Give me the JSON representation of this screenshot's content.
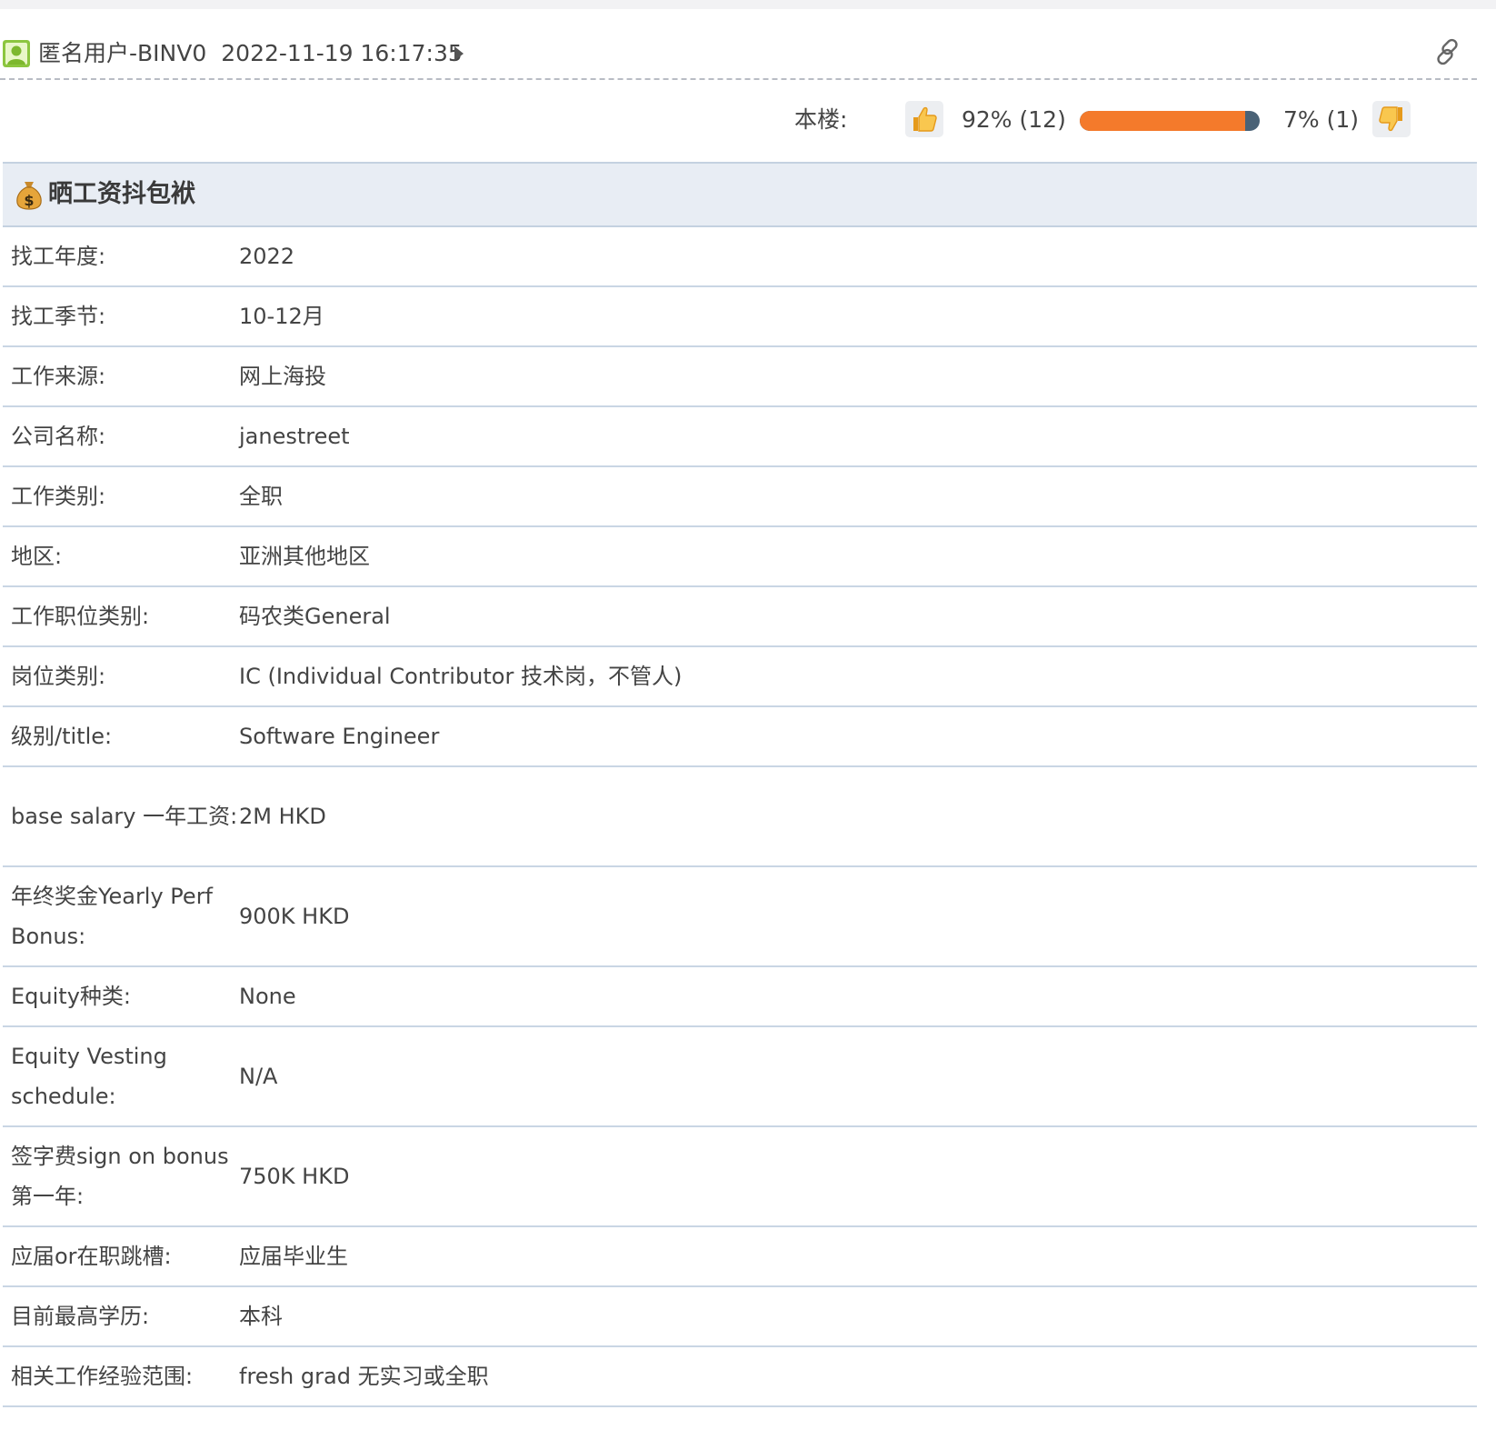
{
  "header": {
    "author": "匿名用户-BINV0",
    "timestamp": "2022-11-19 16:17:35",
    "icons": {
      "avatar": "user-avatar-icon",
      "expand": "caret-right-icon",
      "permalink": "link-icon"
    }
  },
  "votes": {
    "label": "本楼:",
    "up_text": "92% (12)",
    "down_text": "7% (1)",
    "up_fraction": 0.92,
    "colors": {
      "up": "#f47a2b",
      "down": "#4a6276"
    }
  },
  "section": {
    "icon": "money-bag-icon",
    "title": "晒工资抖包袱"
  },
  "rows": [
    {
      "label": "找工年度:",
      "value": "2022"
    },
    {
      "label": "找工季节:",
      "value": "10-12月"
    },
    {
      "label": "工作来源:",
      "value": "网上海投"
    },
    {
      "label": "公司名称:",
      "value": "janestreet"
    },
    {
      "label": "工作类别:",
      "value": "全职"
    },
    {
      "label": "地区:",
      "value": "亚洲其他地区"
    },
    {
      "label": "工作职位类别:",
      "value": "码农类General"
    },
    {
      "label": "岗位类别:",
      "value": "IC (Individual Contributor 技术岗，不管人)"
    },
    {
      "label": "级别/title:",
      "value": "Software Engineer"
    },
    {
      "label": "base salary 一年工资:",
      "value": "2M HKD"
    },
    {
      "label": "年终奖金Yearly Perf Bonus:",
      "value": "900K HKD"
    },
    {
      "label": "Equity种类:",
      "value": "None"
    },
    {
      "label": "Equity Vesting schedule:",
      "value": "N/A"
    },
    {
      "label": "签字费sign on bonus第一年:",
      "value": "750K HKD"
    },
    {
      "label": "应届or在职跳槽:",
      "value": "应届毕业生"
    },
    {
      "label": "目前最高学历:",
      "value": "本科"
    },
    {
      "label": "相关工作经验范围:",
      "value": "fresh grad 无实习或全职"
    }
  ]
}
